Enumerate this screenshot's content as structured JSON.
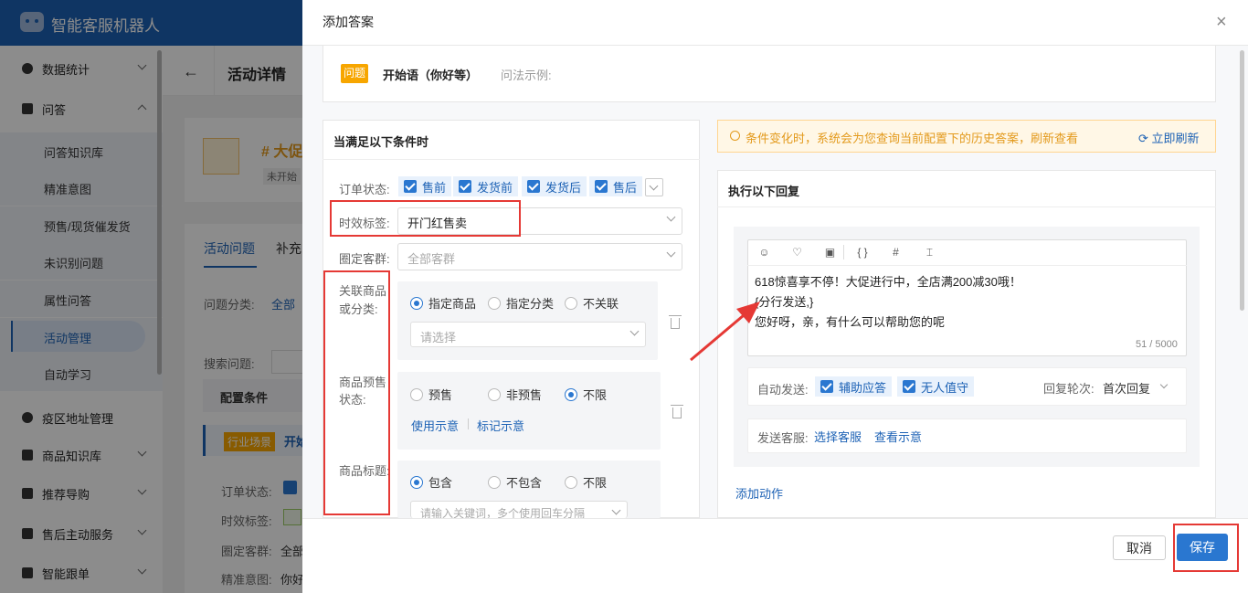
{
  "app": {
    "title": "智能客服机器人"
  },
  "sidebar": {
    "items": [
      {
        "label": "数据统计"
      },
      {
        "label": "问答"
      },
      {
        "label": "疫区地址管理"
      },
      {
        "label": "商品知识库"
      },
      {
        "label": "推荐导购"
      },
      {
        "label": "售后主动服务"
      },
      {
        "label": "智能跟单"
      }
    ],
    "subitems": [
      "问答知识库",
      "精准意图",
      "预售/现货催发货",
      "未识别问题",
      "属性问答",
      "活动管理",
      "自动学习"
    ]
  },
  "background": {
    "back_title": "活动详情",
    "activity_name": "# 大促",
    "status": "未开始",
    "tabs": [
      "活动问题",
      "补充"
    ],
    "question_category_label": "问题分类:",
    "question_category_value": "全部",
    "search_label": "搜索问题:",
    "config_conditions": "配置条件",
    "scene_tag": "行业场景",
    "scene_text": "开始",
    "rows": [
      "订单状态:",
      "时效标签:",
      "圈定客群:",
      "全部",
      "精准意图:",
      "你好"
    ]
  },
  "modal": {
    "title": "添加答案",
    "question_tag": "问题",
    "question_text": "开始语（你好等）",
    "question_hint": "问法示例:",
    "conditions": {
      "title": "当满足以下条件时",
      "order_status_label": "订单状态:",
      "order_status_options": [
        "售前",
        "发货前",
        "发货后",
        "售后"
      ],
      "time_tag_label": "时效标签:",
      "time_tag_value": "开门红售卖",
      "customer_group_label": "圈定客群:",
      "customer_group_placeholder": "全部客群",
      "product_label_1": "关联商品",
      "product_label_2": "或分类:",
      "product_options": [
        "指定商品",
        "指定分类",
        "不关联"
      ],
      "product_select_placeholder": "请选择",
      "presale_label_1": "商品预售",
      "presale_label_2": "状态:",
      "presale_options": [
        "预售",
        "非预售",
        "不限"
      ],
      "usage_example": "使用示意",
      "tag_example": "标记示意",
      "title_label": "商品标题:",
      "title_options": [
        "包含",
        "不包含",
        "不限"
      ],
      "keyword_placeholder": "请输入关键词，多个使用回车分隔"
    },
    "notice": {
      "text": "条件变化时，系统会为您查询当前配置下的历史答案，刷新查看",
      "refresh": "立即刷新"
    },
    "reply": {
      "title": "执行以下回复",
      "toolbar_icons": [
        "emoji-icon",
        "heart-icon",
        "image-icon",
        "braces-icon",
        "hash-icon",
        "split-icon"
      ],
      "toolbar_glyphs": [
        "☺",
        "♡",
        "▣",
        "{ }",
        "#",
        "⌶"
      ],
      "lines": [
        "618惊喜享不停！大促进行中，全店满200减30哦！",
        "{分行发送,}",
        "您好呀，亲，有什么可以帮助您的呢"
      ],
      "counter": "51 / 5000",
      "auto_send_label": "自动发送:",
      "auto_send_options": [
        "辅助应答",
        "无人值守"
      ],
      "reply_round_label": "回复轮次:",
      "reply_round_value": "首次回复",
      "agent_label": "发送客服:",
      "select_agent": "选择客服",
      "view_example": "查看示意",
      "add_action": "添加动作"
    },
    "footer": {
      "cancel": "取消",
      "save": "保存"
    },
    "annotation_color": "#e53935"
  }
}
